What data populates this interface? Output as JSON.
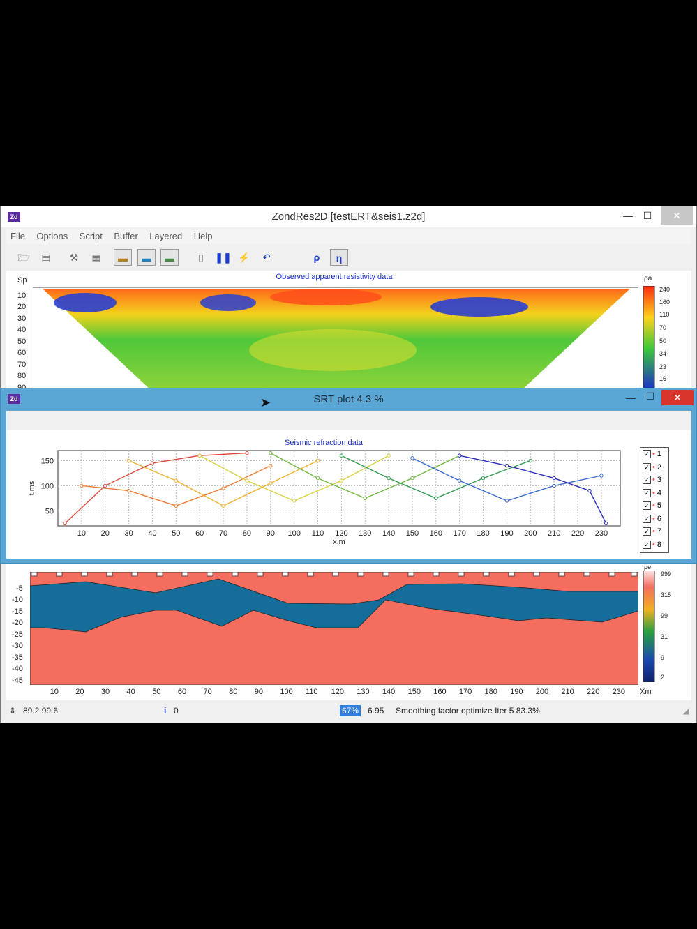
{
  "app": {
    "title": "ZondRes2D [testERT&seis1.z2d]",
    "icon_label": "Zd",
    "window_controls": {
      "minimize": "—",
      "maximize": "☐",
      "close": "✕"
    }
  },
  "menu": [
    "File",
    "Options",
    "Script",
    "Buffer",
    "Layered",
    "Help"
  ],
  "toolbar": {
    "rho_label": "ρ",
    "eta_label": "η",
    "icons": [
      "open-icon",
      "save-icon",
      "tools-icon",
      "grid-icon",
      "view-1-icon",
      "view-2-icon",
      "view-3-icon",
      "page-icon",
      "pause-icon",
      "inversion-1d-icon",
      "undo-icon",
      "rho-icon",
      "eta-icon"
    ]
  },
  "resistivity_panel": {
    "title": "Observed apparent resistivity data",
    "y_axis_label": "Sp",
    "y_ticks": [
      "10",
      "20",
      "30",
      "40",
      "50",
      "60",
      "70",
      "80",
      "90"
    ],
    "colorbar_label": "ρa",
    "colorbar_ticks": [
      "240",
      "160",
      "110",
      "70",
      "50",
      "34",
      "23",
      "16"
    ]
  },
  "srt_window": {
    "title": "SRT plot 4.3 %",
    "icon_label": "Zd",
    "chart_title": "Seismic refraction data",
    "legend": [
      "1",
      "2",
      "3",
      "4",
      "5",
      "6",
      "7",
      "8"
    ]
  },
  "model_panel": {
    "y_ticks": [
      "-5",
      "-10",
      "-15",
      "-20",
      "-25",
      "-30",
      "-35",
      "-40",
      "-45"
    ],
    "x_ticks": [
      "10",
      "20",
      "30",
      "40",
      "50",
      "60",
      "70",
      "80",
      "90",
      "100",
      "110",
      "120",
      "130",
      "140",
      "150",
      "160",
      "170",
      "180",
      "190",
      "200",
      "210",
      "220",
      "230"
    ],
    "x_unit": "Xm",
    "colorbar_label": "ρe",
    "colorbar_ticks": [
      "999",
      "315",
      "99",
      "31",
      "9",
      "2"
    ],
    "colors": {
      "high": "#f46e5f",
      "low": "#146e99"
    }
  },
  "status": {
    "coords": "89.2 99.6",
    "info_value": "0",
    "percent": "67%",
    "value": "6.95",
    "message": "Smoothing factor optimize Iter 5 83.3%"
  },
  "chart_data": {
    "type": "line",
    "title": "Seismic refraction data",
    "xlabel": "x,m",
    "ylabel": "t,ms",
    "xlim": [
      0,
      238
    ],
    "ylim": [
      20,
      170
    ],
    "x_ticks": [
      10,
      20,
      30,
      40,
      50,
      60,
      70,
      80,
      90,
      100,
      110,
      120,
      130,
      140,
      150,
      160,
      170,
      180,
      190,
      200,
      210,
      220,
      230
    ],
    "y_ticks": [
      50,
      100,
      150
    ],
    "grid": true,
    "legend_position": "right",
    "series": [
      {
        "name": "1",
        "x": [
          3,
          20,
          40,
          60,
          80
        ],
        "y": [
          25,
          100,
          145,
          160,
          165
        ]
      },
      {
        "name": "2",
        "x": [
          10,
          30,
          50,
          70,
          90
        ],
        "y": [
          100,
          90,
          60,
          95,
          140
        ]
      },
      {
        "name": "3",
        "x": [
          30,
          50,
          70,
          90,
          110
        ],
        "y": [
          150,
          110,
          60,
          105,
          150
        ]
      },
      {
        "name": "4",
        "x": [
          60,
          80,
          100,
          120,
          140
        ],
        "y": [
          160,
          110,
          70,
          110,
          160
        ]
      },
      {
        "name": "5",
        "x": [
          90,
          110,
          130,
          150,
          170
        ],
        "y": [
          165,
          115,
          75,
          115,
          160
        ]
      },
      {
        "name": "6",
        "x": [
          120,
          140,
          160,
          180,
          200
        ],
        "y": [
          160,
          115,
          75,
          115,
          150
        ]
      },
      {
        "name": "7",
        "x": [
          150,
          170,
          190,
          210,
          230
        ],
        "y": [
          155,
          110,
          70,
          100,
          120
        ]
      },
      {
        "name": "8",
        "x": [
          170,
          190,
          210,
          225,
          232
        ],
        "y": [
          160,
          140,
          115,
          90,
          25
        ]
      }
    ]
  }
}
